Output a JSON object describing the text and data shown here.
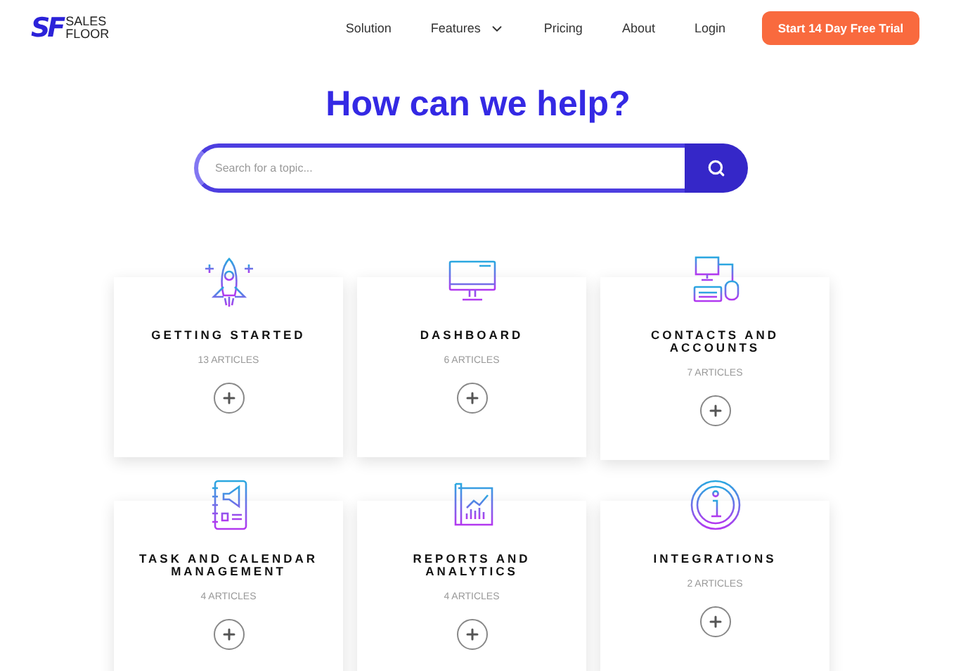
{
  "logo": {
    "mark": "SF",
    "line1": "SALES",
    "line2": "FLOOR"
  },
  "nav": [
    {
      "label": "Solution",
      "dropdown": false
    },
    {
      "label": "Features",
      "dropdown": true
    },
    {
      "label": "Pricing",
      "dropdown": false
    },
    {
      "label": "About",
      "dropdown": false
    },
    {
      "label": "Login",
      "dropdown": false
    }
  ],
  "cta": "Start 14 Day Free Trial",
  "heading": "How can we help?",
  "search": {
    "placeholder": "Search for a topic..."
  },
  "categories": [
    {
      "kind": "rocket",
      "title": "GETTING STARTED",
      "count": "13 ARTICLES"
    },
    {
      "kind": "monitor",
      "title": "DASHBOARD",
      "count": "6 ARTICLES"
    },
    {
      "kind": "computer",
      "title": "CONTACTS AND ACCOUNTS",
      "count": "7 ARTICLES"
    },
    {
      "kind": "notebook",
      "title": "TASK AND CALENDAR MANAGEMENT",
      "count": "4 ARTICLES"
    },
    {
      "kind": "chart",
      "title": "REPORTS AND ANALYTICS",
      "count": "4 ARTICLES"
    },
    {
      "kind": "info",
      "title": "INTEGRATIONS",
      "count": "2 ARTICLES"
    }
  ]
}
